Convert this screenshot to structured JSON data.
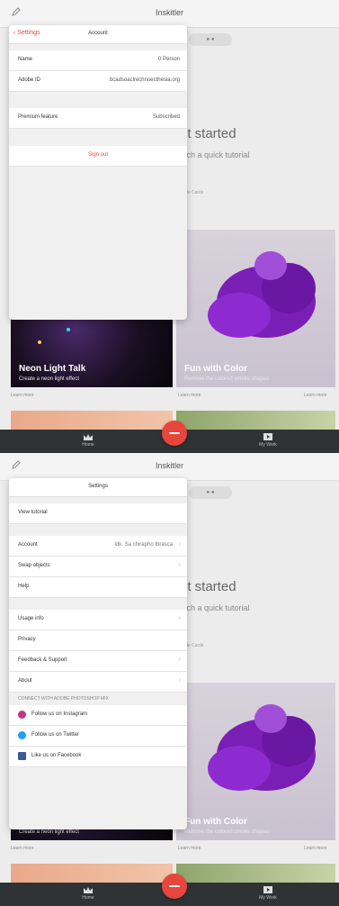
{
  "app_title": "Inskitler",
  "background": {
    "pill_label": "● ●",
    "headline": "et started",
    "subtitle": "atch a quick tutorial",
    "small_label": "ide Cards",
    "card_left": {
      "title": "Neon Light Talk",
      "subtitle": "Create a neon light effect",
      "meta": "Learn more"
    },
    "card_right": {
      "title": "Fun with Color",
      "subtitle": "Remove the colored smoke shapes",
      "meta_left": "Learn more",
      "meta_right": "Learn more"
    },
    "tabs": {
      "home": "Home",
      "mine": "My Work"
    }
  },
  "account_panel": {
    "back_label": "Settings",
    "title": "Account",
    "rows": [
      {
        "label": "Name",
        "value": "0 Person"
      },
      {
        "label": "Adobe ID",
        "value": "bcadsoaclrechnoecthesia.org"
      },
      {
        "label": "Premium feature",
        "value": "Subscribed"
      }
    ],
    "sign_out": "Sign out"
  },
  "settings_panel": {
    "title": "Settings",
    "view_tutorial": "View tutorial",
    "rows_group1": [
      {
        "label": "Account",
        "value": "Idk. Sa chirapho Ibrasca"
      },
      {
        "label": "Swap objects",
        "value": ""
      },
      {
        "label": "Help",
        "value": ""
      }
    ],
    "rows_group2": [
      {
        "label": "Usage info",
        "value": ""
      },
      {
        "label": "Privacy",
        "value": ""
      },
      {
        "label": "Feedback & Support",
        "value": ""
      },
      {
        "label": "About",
        "value": ""
      }
    ],
    "social_header": "CONNECT WITH ADOBE PHOTOSHOP MIX",
    "social": [
      {
        "label": "Follow us on Instagram",
        "color": "#c13584"
      },
      {
        "label": "Follow us on Twitter",
        "color": "#1da1f2"
      },
      {
        "label": "Like us on Facebook",
        "color": "#3b5998"
      }
    ]
  },
  "colors": {
    "accent": "#e8453c",
    "tabbar": "#2f3336"
  }
}
